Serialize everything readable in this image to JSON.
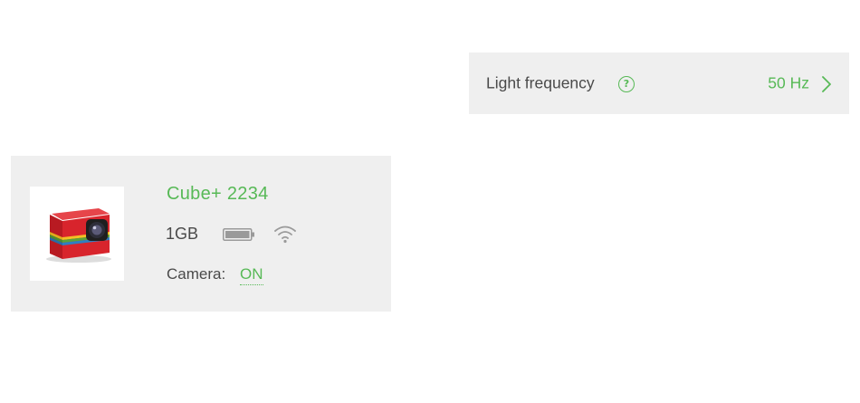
{
  "settings": {
    "light_frequency": {
      "label": "Light frequency",
      "help_glyph": "?",
      "value": "50 Hz",
      "icons": [
        "help-icon",
        "chevron-right-icon"
      ]
    }
  },
  "camera": {
    "name": "Cube+ 2234",
    "storage": "1GB",
    "status_label": "Camera:",
    "status_value": "ON",
    "battery_level": 1.0,
    "icons": [
      "camera-thumbnail",
      "battery-icon",
      "wifi-icon"
    ]
  },
  "colors": {
    "accent": "#57b956",
    "panel_background": "#efefef",
    "text": "#4a4a4a",
    "camera_body": "#d8242c"
  }
}
